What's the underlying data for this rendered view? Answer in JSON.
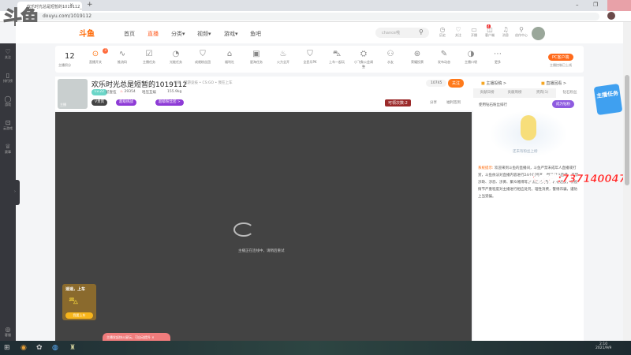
{
  "browser": {
    "tab_title": "欢乐时光总是短暂的1019112_CS:GO直播_斗鱼直播",
    "url": "douyu.com/1019112",
    "new_tab": "+"
  },
  "watermark_logo": "斗鱼",
  "nav": {
    "logo": "斗鱼",
    "items": [
      "首页",
      "直播",
      "分类▾",
      "视频▾",
      "游戏▾",
      "鱼吧"
    ],
    "search_placeholder": "chance哦",
    "icons": [
      {
        "label": "历史",
        "icon": "◷"
      },
      {
        "label": "关注",
        "icon": "♡"
      },
      {
        "label": "开播",
        "icon": "▭"
      },
      {
        "label": "客户端",
        "icon": "◫"
      },
      {
        "label": "消息",
        "icon": "♫"
      },
      {
        "label": "创作中心",
        "icon": "⚲"
      }
    ],
    "client_badge": "4"
  },
  "sidebar": [
    {
      "label": "关注",
      "icon": "♡"
    },
    {
      "label": "排行榜",
      "icon": "▯"
    },
    {
      "label": "游戏",
      "icon": "◯"
    },
    {
      "label": "云游戏",
      "icon": "⊡"
    },
    {
      "label": "赛事",
      "icon": "♕"
    }
  ],
  "sidebar_bottom": {
    "label": "客服",
    "icon": "◎"
  },
  "toolbar": {
    "score": "12",
    "score_label": "主播积分",
    "live_switch_badge": "3",
    "items": [
      {
        "label": "直播开关",
        "icon": "⊙"
      },
      {
        "label": "推流码",
        "icon": "∿"
      },
      {
        "label": "主播任务",
        "icon": "☑"
      },
      {
        "label": "光能任务",
        "icon": "◔"
      },
      {
        "label": "成就粉丝团",
        "icon": "⛉"
      },
      {
        "label": "福利社",
        "icon": "⌂"
      },
      {
        "label": "星海任务",
        "icon": "▣"
      },
      {
        "label": "火力全开",
        "icon": "♨"
      },
      {
        "label": "全民乐PK",
        "icon": "⛉"
      },
      {
        "label": "上车一起玩",
        "icon": "⛍"
      },
      {
        "label": "小飞象公会调整",
        "icon": "⛭"
      },
      {
        "label": "水友",
        "icon": "⚇"
      },
      {
        "label": "荣耀投票",
        "icon": "⊛"
      },
      {
        "label": "发布动态",
        "icon": "✎"
      },
      {
        "label": "主播口袋",
        "icon": "◑"
      },
      {
        "label": "更多",
        "icon": "⋯"
      }
    ],
    "pc_client": "PC客户端",
    "pc_sub": "主播控制已上线"
  },
  "room": {
    "title": "欢乐时光总是短暂的1019112",
    "report": "举报",
    "category": "网游竞技 • CS:GO • 我在上车",
    "level": "Lv.22",
    "anchor_name": "贰壹伍",
    "hot": "29354",
    "org": "哈压互娱",
    "weight": "155.9kg",
    "badge1": "V贵宾",
    "badge2": "超级挑战",
    "badge3": "超级粉丝团 >",
    "followers": "10745",
    "follow": "关注",
    "claim": "可领次数:2",
    "share": "分享",
    "checkin": "福利签到",
    "avatar_tag": "主播"
  },
  "video": {
    "status": "主播正在连线中，请稍后重试",
    "promo_title": "速速，上车",
    "promo_button": "我要上车",
    "toast": "主播发起快火星玩，可自动提升",
    "toast_close": "×"
  },
  "right_panel": {
    "link1": "主播投稿 >",
    "link2": "直播回看 >",
    "tabs": [
      "贡献日榜",
      "贡献周榜",
      "贵宾(1)",
      "钻石粉丝"
    ],
    "diamond_text": "使用钻石粉丝排行",
    "diamond_button": "成为钻粉",
    "empty": "还未有粉丝上榜",
    "notice_label": "系统提示:",
    "notice": "欢迎来到斗鱼的直播间，斗鱼严禁未成年人直播或打赏，斗鱼依法对直播内容进行24小时巡查，倡导绿色直播，严禁涉政、涉恐、涉黄、聚众赌博等违法违规内容，若有违反，将视情节严重程度对主播进行相应处罚。理性消费，警惕诈骗，谨防上当受骗。"
  },
  "overlay_watermark": "水友群:737140047",
  "ad": "主播任务",
  "taskbar": {
    "time": "2:10",
    "date": "2021/9/9"
  },
  "colors": {
    "accent": "#ff7a1b",
    "purple": "#8e3bd6",
    "sidebar": "#36373d",
    "video": "#434343"
  }
}
